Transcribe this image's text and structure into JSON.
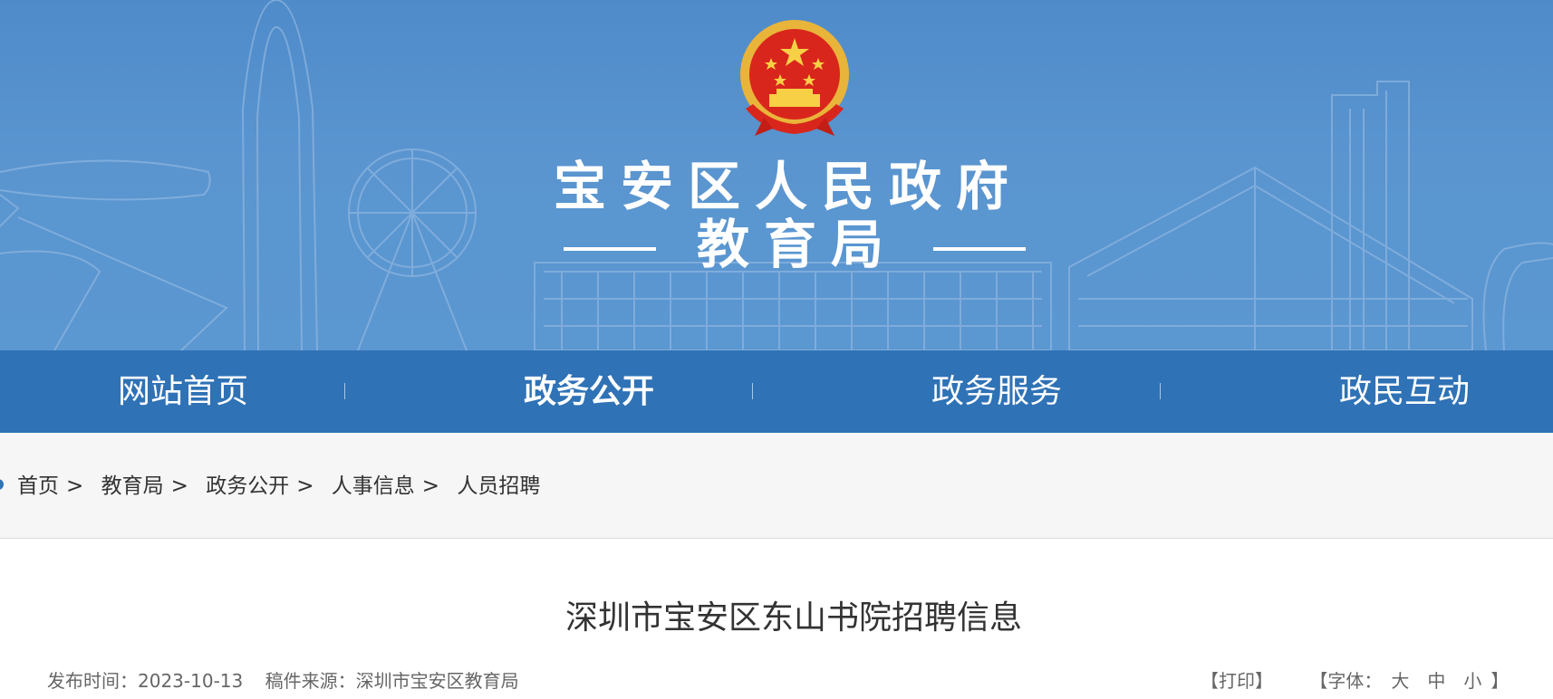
{
  "banner": {
    "org_name": "宝安区人民政府",
    "dept_name": "教育局",
    "colors": {
      "background": "#5490cd",
      "text": "#ffffff"
    },
    "emblem_icon": "national-emblem"
  },
  "nav": {
    "items": [
      {
        "label": "网站首页",
        "active": false
      },
      {
        "label": "政务公开",
        "active": true
      },
      {
        "label": "政务服务",
        "active": false
      },
      {
        "label": "政民互动",
        "active": false
      }
    ],
    "colors": {
      "background": "#2f72b6",
      "text": "#ffffff"
    }
  },
  "breadcrumb": {
    "items": [
      "首页",
      "教育局",
      "政务公开",
      "人事信息",
      "人员招聘"
    ],
    "separator": ">"
  },
  "article": {
    "title": "深圳市宝安区东山书院招聘信息",
    "publish_label": "发布时间：",
    "publish_date": "2023-10-13",
    "source_label": "稿件来源：",
    "source": "深圳市宝安区教育局",
    "print_label": "【打印】",
    "font_label_open": "【字体：",
    "font_large": "大",
    "font_medium": "中",
    "font_small": "小",
    "font_label_close": "】"
  }
}
